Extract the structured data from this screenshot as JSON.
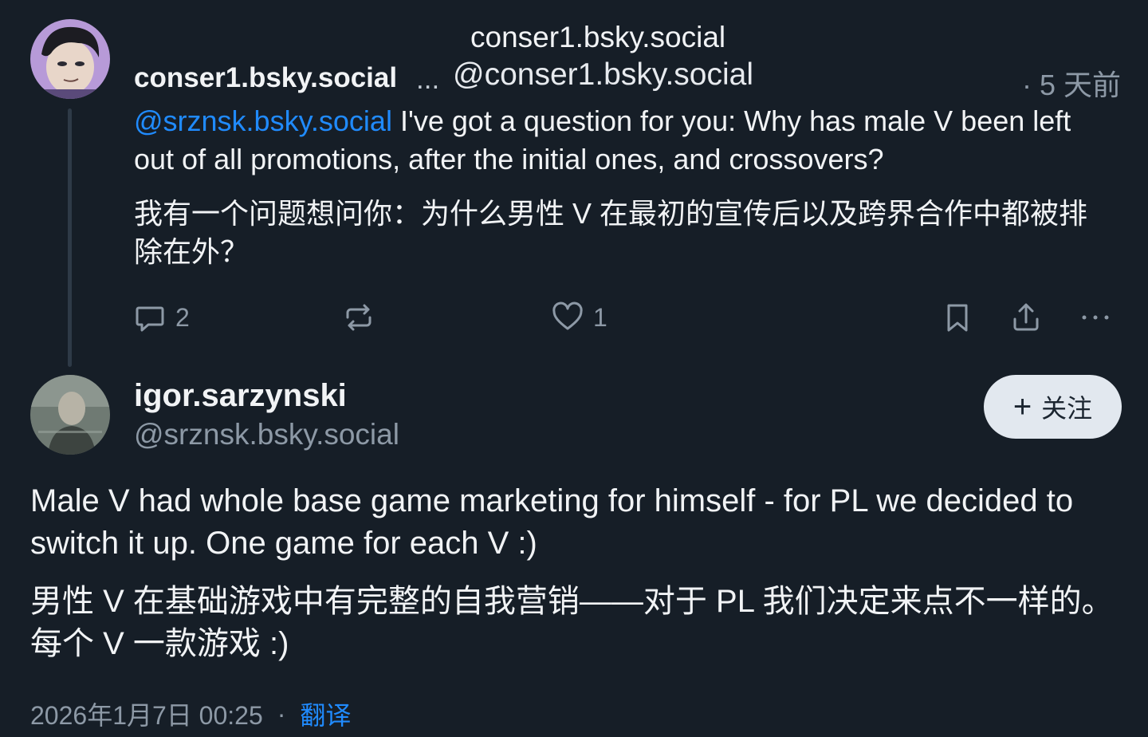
{
  "parent_post": {
    "display_name": "conser1.bsky.social",
    "ellipsis": "...",
    "tooltip_name": "conser1.bsky.social",
    "handle": "@conser1.bsky.social",
    "timestamp": "· 5 天前",
    "mention": "@srznsk.bsky.social",
    "text": " I've got a question for you: Why has male V been left out of all promotions, after the initial ones, and crossovers?",
    "translation": " 我有一个问题想问你：为什么男性 V 在最初的宣传后以及跨界合作中都被排除在外？",
    "actions": {
      "reply_count": "2",
      "repost_count": "",
      "like_count": "1"
    }
  },
  "reply_post": {
    "display_name": "igor.sarzynski",
    "handle": "@srznsk.bsky.social",
    "follow_label": "关注",
    "text": "Male V had whole base game marketing for himself - for PL we decided to switch it up. One game for each V :)",
    "translation": "男性 V 在基础游戏中有完整的自我营销——对于 PL 我们决定来点不一样的。每个 V 一款游戏 :)",
    "datetime": "2026年1月7日 00:25",
    "separator": "·",
    "translate_label": "翻译"
  },
  "colors": {
    "background": "#161e27",
    "link": "#208bfe",
    "muted": "#8d99a6",
    "follow_bg": "#e2e8ef"
  },
  "icons": [
    "reply-icon",
    "repost-icon",
    "like-icon",
    "bookmark-icon",
    "share-icon",
    "more-icon",
    "plus-icon"
  ]
}
